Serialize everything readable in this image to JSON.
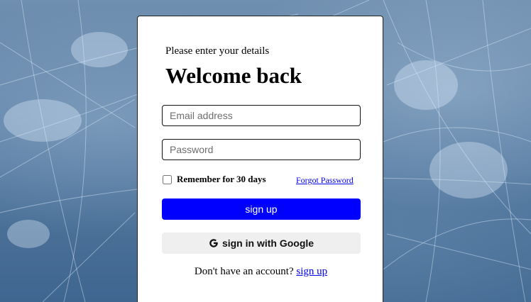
{
  "login": {
    "subtitle": "Please enter your details",
    "title": "Welcome back",
    "email_placeholder": "Email address",
    "password_placeholder": "Password",
    "remember_label": "Remember for 30 days",
    "forgot_link": "Forgot Password",
    "signup_button": "sign up",
    "google_button": "sign in with Google",
    "footer_text": "Don't have an account?",
    "footer_link": "sign up"
  },
  "icons": {
    "google": "google-g-icon"
  },
  "colors": {
    "primary_button": "#0000ff",
    "link": "#0000ee",
    "google_button_bg": "#efefef"
  }
}
